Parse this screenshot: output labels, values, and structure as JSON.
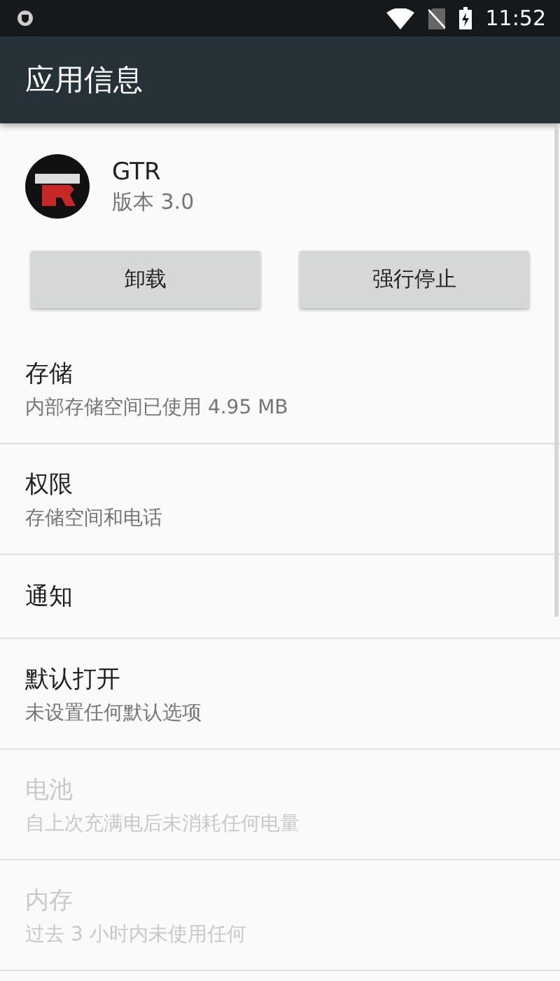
{
  "status_bar": {
    "time": "11:52"
  },
  "app_bar": {
    "title": "应用信息"
  },
  "app": {
    "name": "GTR",
    "version": "版本 3.0"
  },
  "buttons": [
    {
      "label": "卸载"
    },
    {
      "label": "强行停止"
    }
  ],
  "settings": [
    {
      "title": "存储",
      "summary": "内部存储空间已使用 4.95 MB",
      "disabled": false
    },
    {
      "title": "权限",
      "summary": "存储空间和电话",
      "disabled": false
    },
    {
      "title": "通知",
      "disabled": false
    },
    {
      "title": "默认打开",
      "summary": "未设置任何默认选项",
      "disabled": false
    },
    {
      "title": "电池",
      "summary": "自上次充满电后未消耗任何电量",
      "disabled": true
    },
    {
      "title": "内存",
      "summary": "过去 3 小时内未使用任何",
      "disabled": true
    }
  ]
}
